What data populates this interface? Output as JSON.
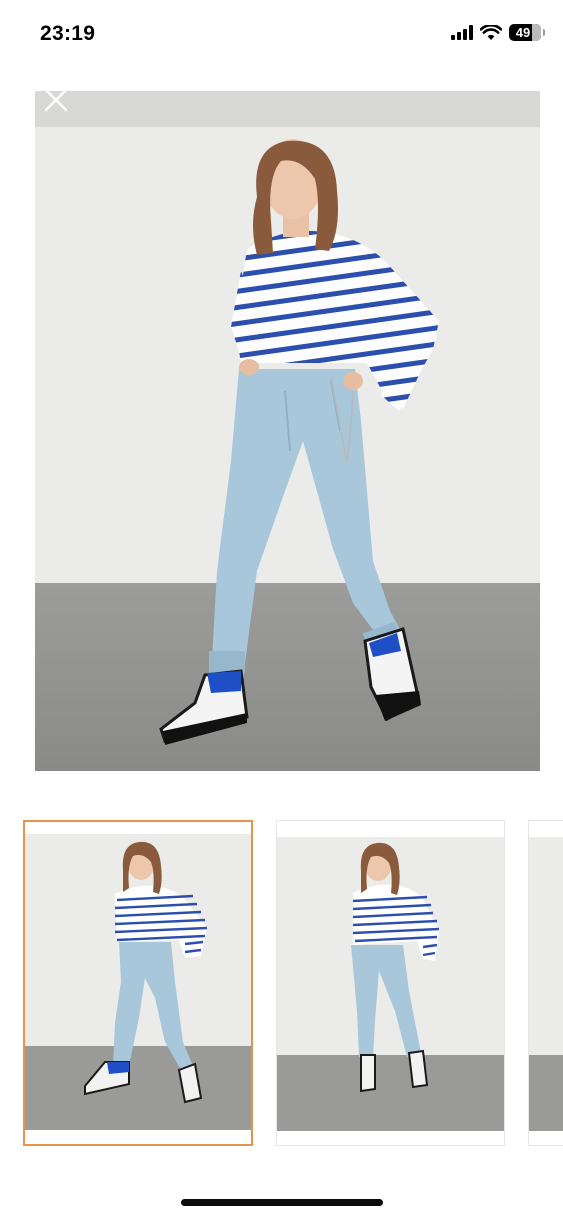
{
  "status_bar": {
    "time": "23:19",
    "battery_level": "49",
    "icons": [
      "signal-icon",
      "wifi-icon",
      "battery-icon"
    ]
  },
  "viewer": {
    "close_icon": "close-icon",
    "thumbnail_count": 3,
    "selected_thumbnail": 1
  },
  "colors": {
    "selected_border": "#e8914a",
    "background": "#ffffff"
  }
}
